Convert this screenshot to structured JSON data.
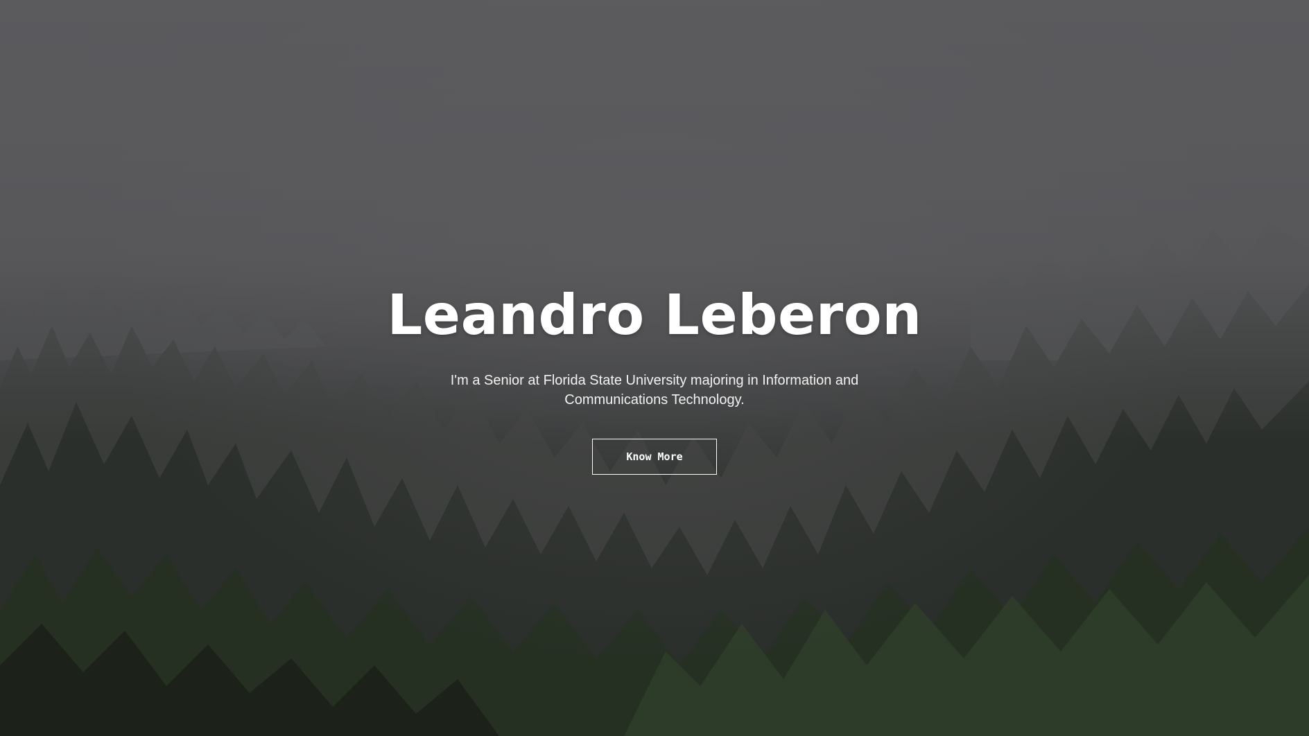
{
  "hero": {
    "title": "Leandro Leberon",
    "subtitle": "I'm a Senior at Florida State University majoring in Information and Communications Technology.",
    "button_label": "Know More",
    "background": "misty-pine-forest-photo"
  },
  "colors": {
    "text": "#ffffff",
    "fog": "#5b5b5e",
    "forest": "#1d2119"
  }
}
